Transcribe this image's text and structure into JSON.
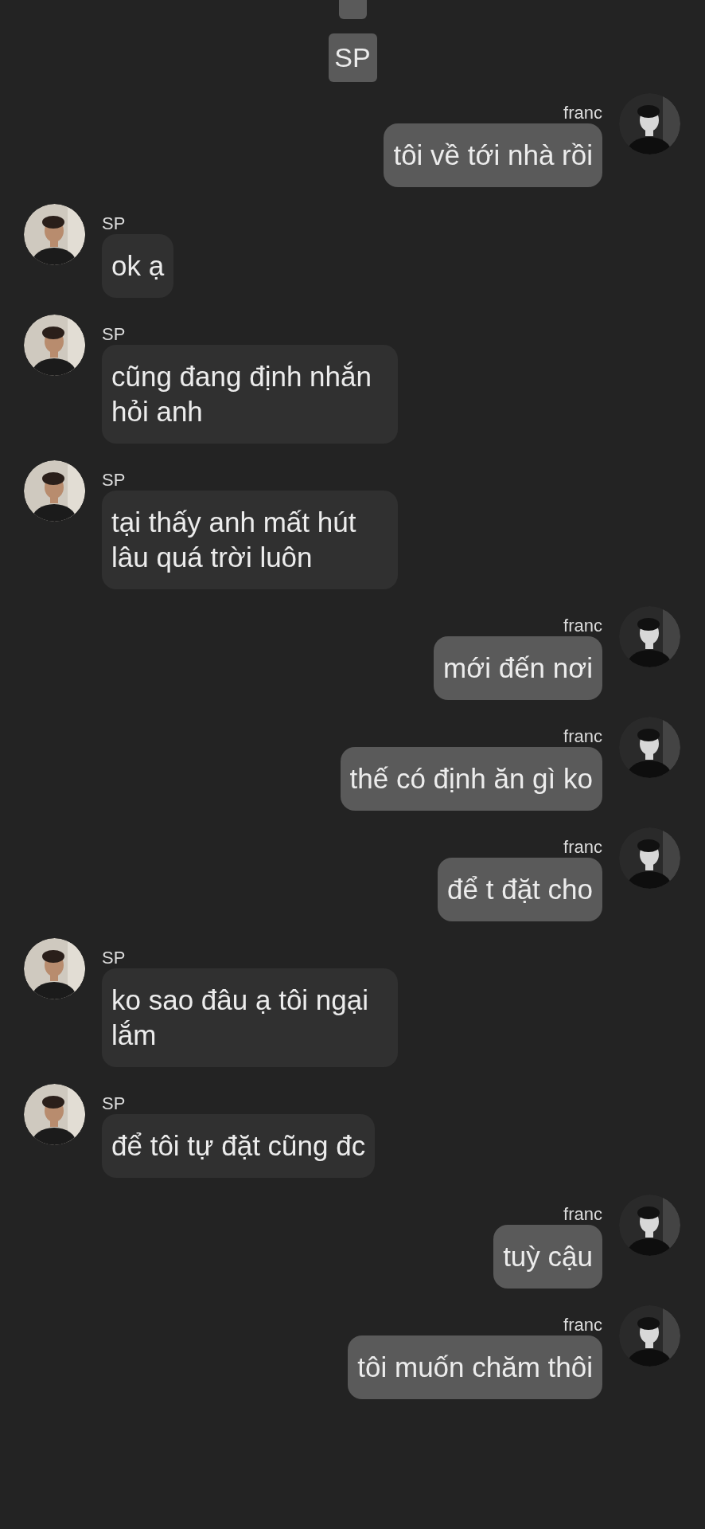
{
  "header": {
    "badge": "SP"
  },
  "messages": [
    {
      "kind": "outgoing",
      "sender": "franc",
      "text": "tôi về tới nhà rồi"
    },
    {
      "kind": "incoming",
      "sender": "SP",
      "text": "ok ạ"
    },
    {
      "kind": "incoming",
      "sender": "SP",
      "text": "cũng đang định nhắn hỏi anh"
    },
    {
      "kind": "incoming",
      "sender": "SP",
      "text": "tại thấy anh mất hút lâu quá trời luôn"
    },
    {
      "kind": "outgoing",
      "sender": "franc",
      "text": "mới đến nơi"
    },
    {
      "kind": "outgoing",
      "sender": "franc",
      "text": "thế có định ăn gì ko"
    },
    {
      "kind": "outgoing",
      "sender": "franc",
      "text": "để t đặt cho"
    },
    {
      "kind": "incoming",
      "sender": "SP",
      "text": "ko sao đâu ạ tôi ngại lắm"
    },
    {
      "kind": "incoming",
      "sender": "SP",
      "text": "để tôi tự đặt cũng đc"
    },
    {
      "kind": "outgoing",
      "sender": "franc",
      "text": "tuỳ cậu"
    },
    {
      "kind": "outgoing",
      "sender": "franc",
      "text": "tôi muốn chăm thôi"
    }
  ]
}
